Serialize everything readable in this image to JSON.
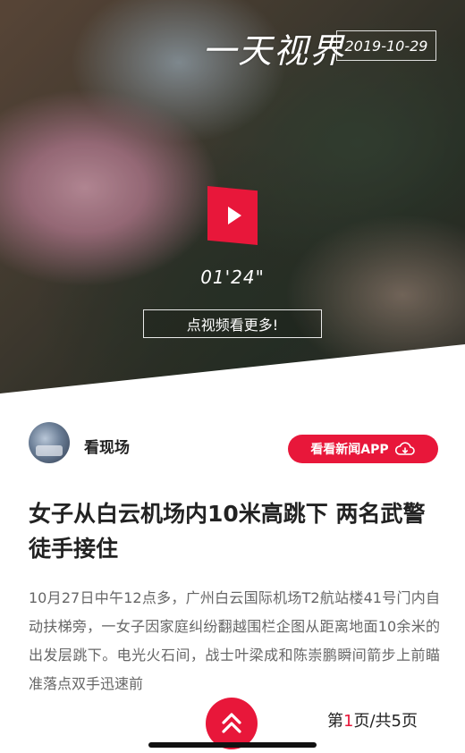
{
  "hero": {
    "logo_text": "一天视界",
    "date": "2019-10-29",
    "play_icon": "play-icon",
    "duration": "01'24\"",
    "more_button": "点视频看更多!"
  },
  "author": {
    "name": "看现场",
    "app_button": "看看新闻APP",
    "app_icon": "cloud-download-icon"
  },
  "article": {
    "headline": "女子从白云机场内10米高跳下 两名武警徒手接住",
    "body": "10月27日中午12点多，广州白云国际机场T2航站楼41号门内自动扶梯旁，一女子因家庭纠纷翻越围栏企图从距离地面10余米的出发层跳下。电光火石间，战士叶梁成和陈崇鹏瞬间箭步上前瞄准落点双手迅速前"
  },
  "pager": {
    "prefix": "第",
    "current": "1",
    "suffix": "页/共5页",
    "up_icon": "double-chevron-up-icon"
  },
  "colors": {
    "accent": "#e8173a"
  }
}
